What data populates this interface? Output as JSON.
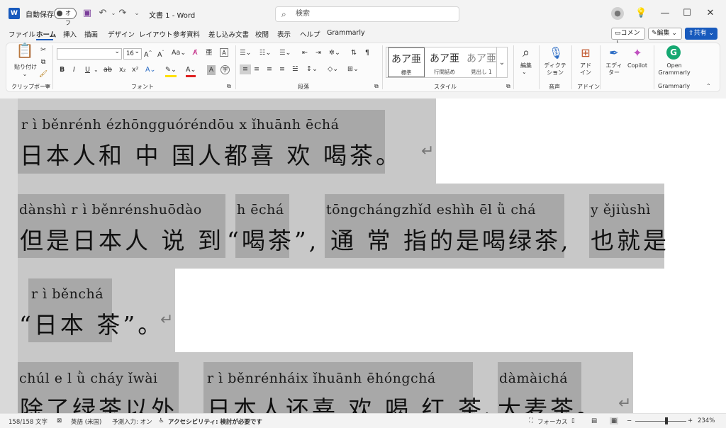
{
  "titlebar": {
    "autosave_label": "自動保存",
    "autosave_state": "オフ",
    "doc_title": "文書 1  -  Word",
    "search_placeholder": "検索",
    "undo_icon": "undo-icon",
    "redo_icon": "redo-icon"
  },
  "menu": {
    "items": [
      "ファイル",
      "ホーム",
      "挿入",
      "描画",
      "デザイン",
      "レイアウト",
      "参考資料",
      "差し込み文書",
      "校閲",
      "表示",
      "ヘルプ",
      "Grammarly"
    ],
    "active": "ホーム",
    "comment_label": "コメント",
    "edit_label": "編集",
    "share_label": "共有"
  },
  "ribbon": {
    "clipboard": {
      "paste_label": "貼り付け",
      "group_label": "クリップボード"
    },
    "font": {
      "font_name": "",
      "font_size": "16",
      "group_label": "フォント",
      "case_label": "Aa"
    },
    "paragraph": {
      "group_label": "段落"
    },
    "styles": {
      "group_label": "スタイル",
      "items": [
        {
          "sample": "あア亜",
          "name": "標準"
        },
        {
          "sample": "あア亜",
          "name": "行間詰め"
        },
        {
          "sample": "あア亜",
          "name": "見出し 1"
        }
      ]
    },
    "editing": {
      "label": "編集"
    },
    "voice": {
      "label1": "ディクテー",
      "label2": "ション",
      "group_label": "音声"
    },
    "addins": {
      "label1": "アド",
      "label2": "イン",
      "group_label": "アドイン"
    },
    "editor": {
      "label1": "エディ",
      "label2": "ター"
    },
    "copilot": {
      "label": "Copilot"
    },
    "grammarly": {
      "label1": "Open",
      "label2": "Grammarly",
      "group_label": "Grammarly"
    }
  },
  "document": {
    "line1": {
      "pinyin": "r ì běnrénh ézhōngguóréndōu x ǐhuānh ēchá",
      "hanzi": "日本人和 中 国人都喜 欢 喝茶。"
    },
    "line2": {
      "pinyin_a": "dànshì r ì běnrénshuōdào",
      "hanzi_a": "但是日本人 说 到",
      "pinyin_b": "h ēchá",
      "hanzi_b": "“喝茶”,",
      "pinyin_c": "tōngchángzhǐd eshìh ēl ǜ chá",
      "hanzi_c": "通  常  指的是喝绿茶,",
      "pinyin_d": "y ějiùshì",
      "hanzi_d": "也就是"
    },
    "line3": {
      "pinyin": "r ì běnchá",
      "hanzi": "“日本 茶”。"
    },
    "line4": {
      "pinyin_a": "chúl e l ǜ cháy ǐwài",
      "hanzi_a": "除了绿茶以外,",
      "pinyin_b": "r ì běnrénháix ǐhuānh ēhóngchá",
      "hanzi_b": "日本人还喜 欢 喝 红 茶、",
      "pinyin_c": "dàmàichá",
      "hanzi_c": "大麦茶。"
    }
  },
  "statusbar": {
    "word_count": "158/158 文字",
    "language": "英語 (米国)",
    "predict": "予測入力: オン",
    "accessibility": "アクセシビリティ: 検討が必要です",
    "focus": "フォーカス",
    "zoom": "234%"
  }
}
